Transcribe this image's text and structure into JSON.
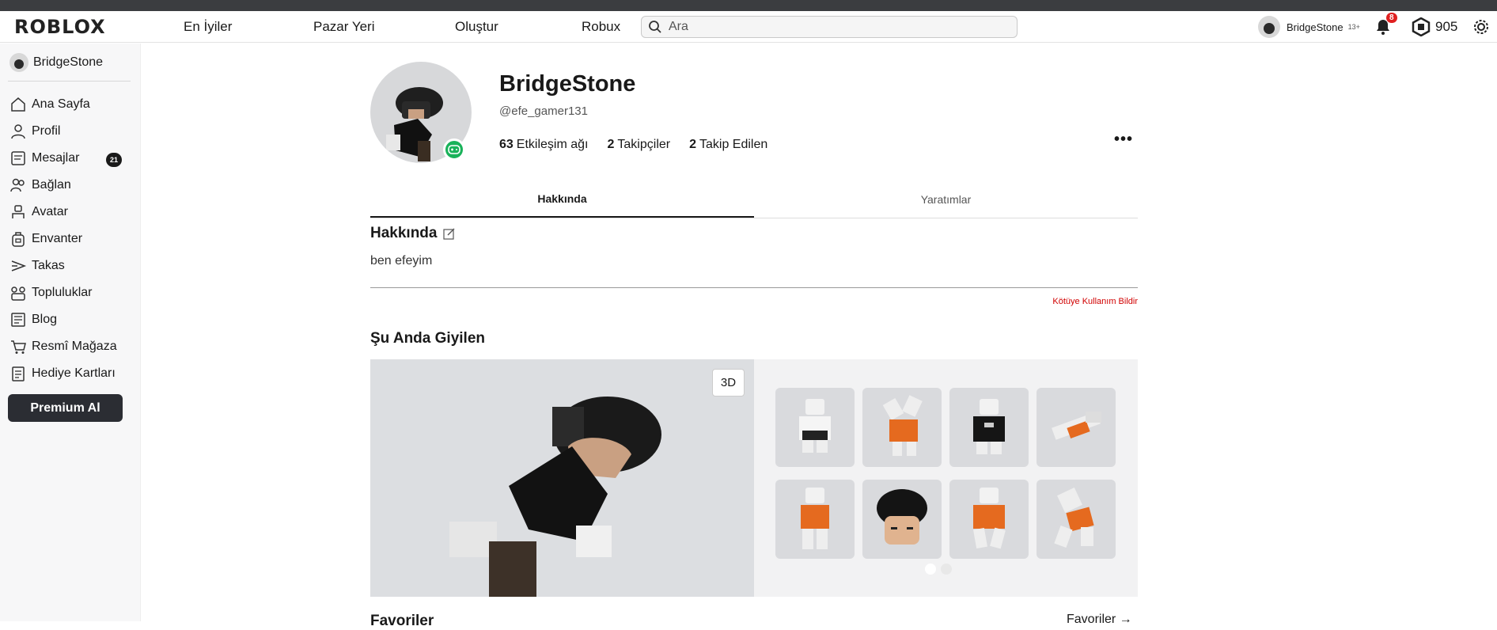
{
  "topbar": {
    "logo": "ROBLOX",
    "nav": [
      "En İyiler",
      "Pazar Yeri",
      "Oluştur",
      "Robux"
    ],
    "search_placeholder": "Ara",
    "username": "BridgeStone",
    "age_badge": "13+",
    "notifications": "8",
    "robux": "905"
  },
  "sidebar": {
    "username": "BridgeStone",
    "items": [
      {
        "label": "Ana Sayfa",
        "icon": "home-icon"
      },
      {
        "label": "Profil",
        "icon": "profile-icon"
      },
      {
        "label": "Mesajlar",
        "icon": "messages-icon",
        "badge": "21"
      },
      {
        "label": "Bağlan",
        "icon": "connect-icon"
      },
      {
        "label": "Avatar",
        "icon": "avatar-icon"
      },
      {
        "label": "Envanter",
        "icon": "inventory-icon"
      },
      {
        "label": "Takas",
        "icon": "trade-icon"
      },
      {
        "label": "Topluluklar",
        "icon": "groups-icon"
      },
      {
        "label": "Blog",
        "icon": "blog-icon"
      },
      {
        "label": "Resmî Mağaza",
        "icon": "store-icon"
      },
      {
        "label": "Hediye Kartları",
        "icon": "gift-card-icon"
      }
    ],
    "premium_label": "Premium Al"
  },
  "profile": {
    "display_name": "BridgeStone",
    "handle": "@efe_gamer131",
    "stats": [
      {
        "value": "63",
        "label": "Etkileşim ağı"
      },
      {
        "value": "2",
        "label": "Takipçiler"
      },
      {
        "value": "2",
        "label": "Takip Edilen"
      }
    ],
    "more": "•••"
  },
  "tabs": [
    "Hakkında",
    "Yaratımlar"
  ],
  "about": {
    "title": "Hakkında",
    "text": "ben efeyim",
    "report": "Kötüye Kullanım Bildir"
  },
  "wearing": {
    "title": "Şu Anda Giyilen",
    "btn_3d": "3D"
  },
  "favorites": {
    "title": "Favoriler",
    "link": "Favoriler →"
  },
  "colors": {
    "online": "#19b25a",
    "badge_red": "#e02020",
    "report_red": "#d10000",
    "premium_bg": "#2b2d33"
  }
}
